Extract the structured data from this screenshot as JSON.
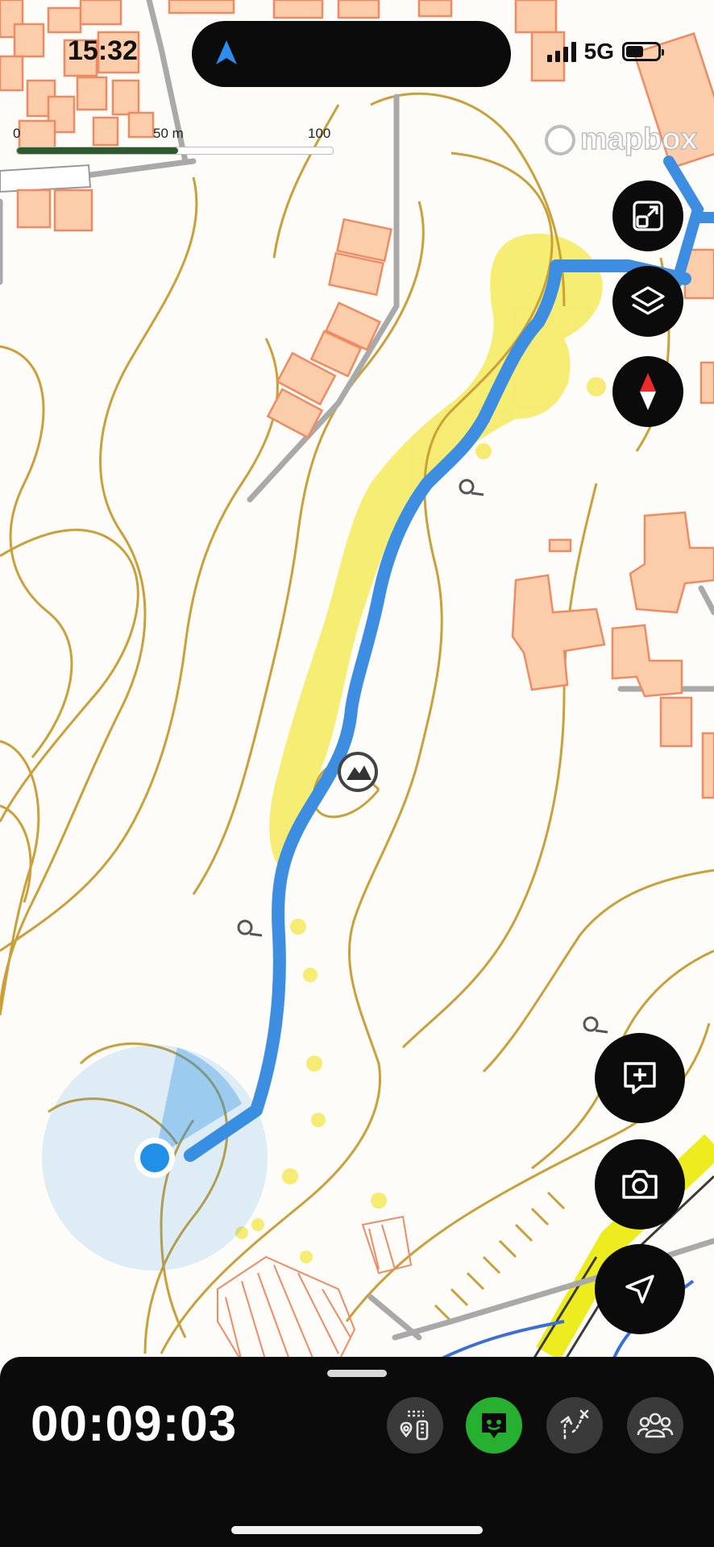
{
  "status_bar": {
    "time": "15:32",
    "network": "5G",
    "battery_level": 0.55
  },
  "map": {
    "scale": {
      "zero": "0",
      "mid": "50 m",
      "end": "100 m"
    },
    "attribution": "mapbox",
    "colors": {
      "track": "#3d8ee0",
      "contour": "#c9a03a",
      "buildings_fill": "#fbcdaa",
      "buildings_stroke": "#ef8b63",
      "vegetation": "#f5ea5c",
      "location": "#1f90e6"
    }
  },
  "map_controls": {
    "icons": [
      "fit-route-icon",
      "layers-icon",
      "compass-icon"
    ]
  },
  "action_buttons": {
    "icons": [
      "add-note-icon",
      "camera-icon",
      "navigate-icon"
    ]
  },
  "recording_bar": {
    "elapsed_time": "00:09:03",
    "tools": [
      "waypoints-icon",
      "beacon-icon",
      "route-icon",
      "group-icon"
    ],
    "active_tool": "beacon-icon"
  }
}
